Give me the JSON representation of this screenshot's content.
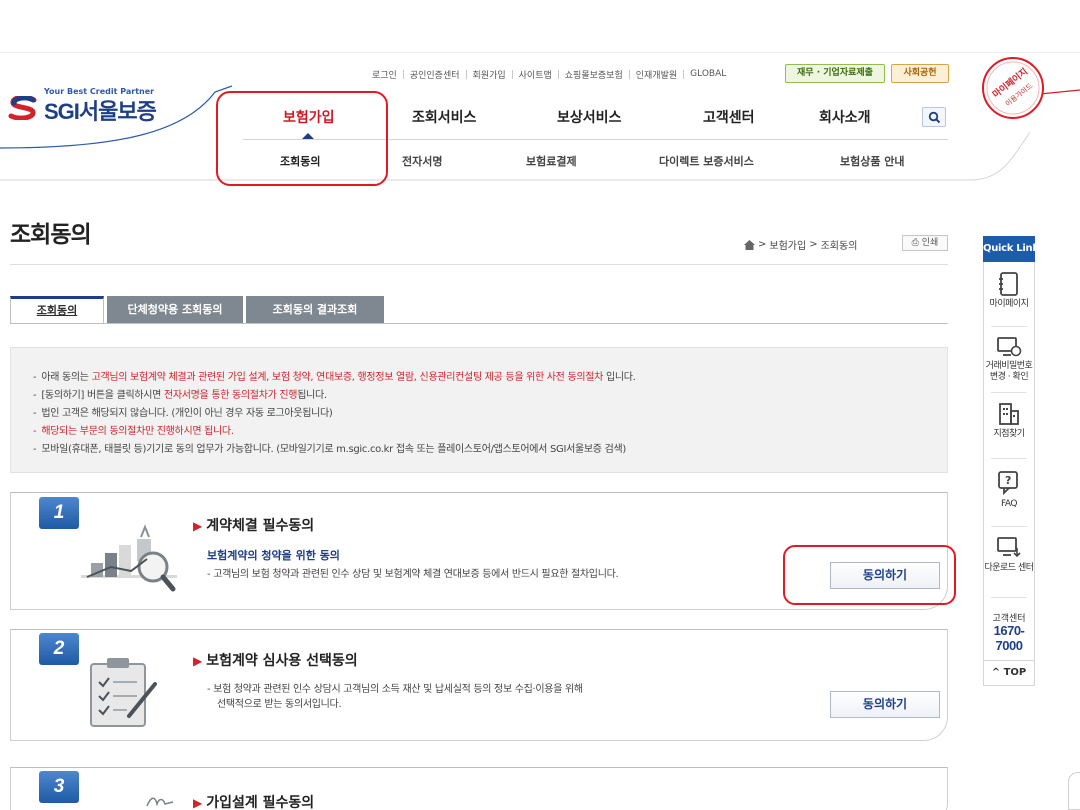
{
  "util_nav": [
    "로그인",
    "공인인증센터",
    "회원가입",
    "사이트맵",
    "쇼핑몰보증보험",
    "인재개발원",
    "GLOBAL"
  ],
  "util_pills": {
    "finance": "재무 · 기업자료제출",
    "social": "사회공헌"
  },
  "logo": {
    "tagline": "Your Best Credit Partner",
    "name": "SGI서울보증"
  },
  "gnb": [
    "보험가입",
    "조회서비스",
    "보상서비스",
    "고객센터",
    "회사소개"
  ],
  "sub_nav": [
    "조회동의",
    "전자서명",
    "보험료결제",
    "다이렉트 보증서비스",
    "보험상품 안내"
  ],
  "mypage_badge": {
    "line1": "마이페이지",
    "line2": "이용가이드"
  },
  "page": {
    "title": "조회동의",
    "breadcrumb": [
      "보험가입",
      "조회동의"
    ],
    "print_label": "인쇄"
  },
  "tabs": [
    "조회동의",
    "단체청약용 조회동의",
    "조회동의 결과조회"
  ],
  "notice": [
    {
      "pre": "아래 동의는 ",
      "hl": "고객님의 보험계약 체결과 관련된 가입 설계, 보험 청약, 연대보증, 행정정보 열람, 신용관리컨설팅 제공 등을 위한 사전 동의절차",
      "post": " 입니다."
    },
    {
      "pre": "[동의하기] 버튼을 클릭하시면 ",
      "hl": "전자서명을 통한 동의절차가 진행",
      "post": "됩니다."
    },
    {
      "pre": "법인 고객은 해당되지 않습니다. (개인이 아닌 경우 자동 로그아웃됩니다)",
      "hl": "",
      "post": ""
    },
    {
      "pre": "",
      "hl": "해당되는 부문의 동의절차만 진행하시면 됩니다.",
      "post": ""
    },
    {
      "pre": "모바일(휴대폰, 태블릿 등)기기로 동의 업무가 가능합니다. (모바일기기로 m.sgic.co.kr 접속 또는 플레이스토어/앱스토어에서 SGI서울보증 검색)",
      "hl": "",
      "post": ""
    }
  ],
  "cards": [
    {
      "number": "1",
      "title": "계약체결 필수동의",
      "subtitle": "보험계약의 청약을 위한 동의",
      "desc": [
        "고객님의 보험 청약과 관련된 인수 상담 및 보험계약 체결 연대보증 등에서 반드시 필요한 절차입니다."
      ],
      "button": "동의하기"
    },
    {
      "number": "2",
      "title": "보험계약 심사용 선택동의",
      "subtitle": "",
      "desc": [
        "보험 청약과 관련된 인수 상담시 고객님의 소득 재산 및 납세실적 등의 정보 수집·이용을 위해",
        "선택적으로 받는 동의서입니다."
      ],
      "button": "동의하기"
    },
    {
      "number": "3",
      "title": "가입설계 필수동의",
      "subtitle": "",
      "desc": [],
      "button": ""
    }
  ],
  "quick_link": {
    "title": "Quick Link",
    "items": [
      {
        "label": "마이페이지",
        "icon": "notebook-icon"
      },
      {
        "label": "거래비밀번호 변경 · 확인",
        "label_lines": [
          "거래비밀번호",
          "변경 · 확인"
        ],
        "icon": "monitor-lock-icon"
      },
      {
        "label": "지점찾기",
        "icon": "building-icon"
      },
      {
        "label": "FAQ",
        "icon": "question-chat-icon"
      },
      {
        "label": "다운로드 센터",
        "icon": "monitor-download-icon"
      }
    ],
    "phone_label": "고객센터",
    "phone": "1670-7000",
    "top_label": "TOP"
  },
  "colors": {
    "brand_navy": "#1d3f86",
    "brand_red": "#cc1b24",
    "quick_blue": "#1d5cab",
    "tab_gray": "#7f8790"
  }
}
